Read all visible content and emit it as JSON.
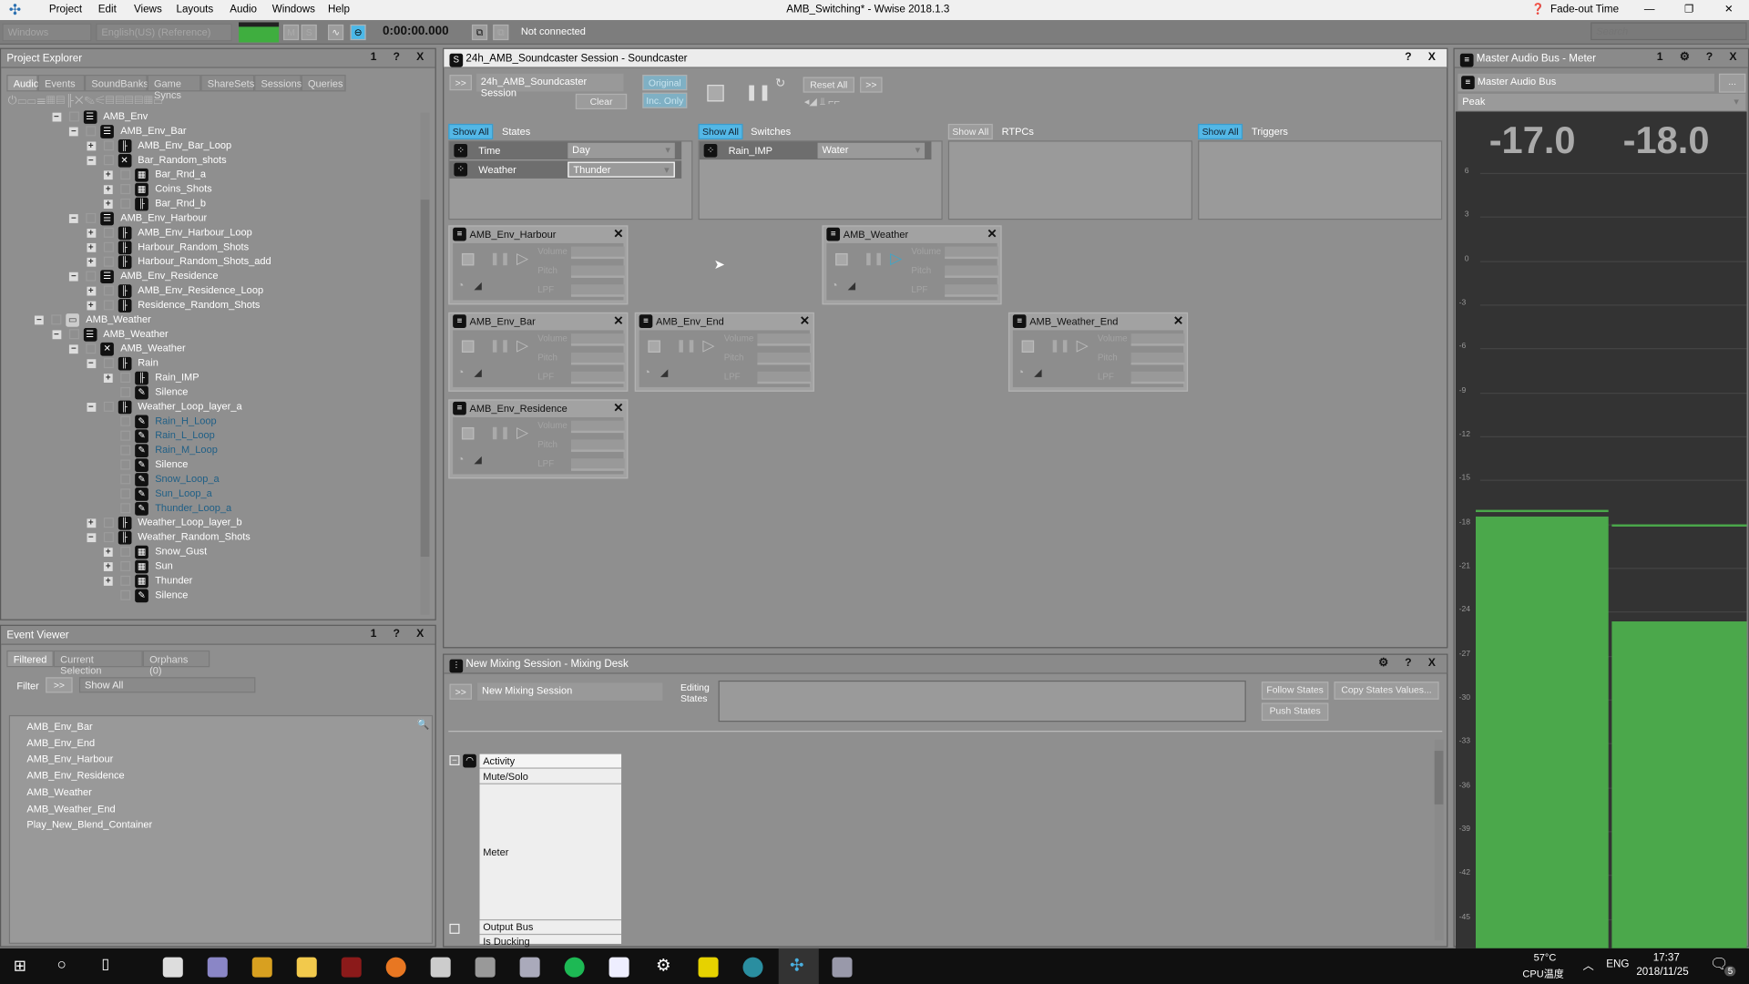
{
  "app": {
    "title": "AMB_Switching* - Wwise 2018.1.3",
    "fade_out": "Fade-out Time",
    "menu": [
      "Project",
      "Edit",
      "Views",
      "Layouts",
      "Audio",
      "Windows",
      "Help"
    ]
  },
  "toolbar": {
    "platform": "Windows",
    "language": "English(US) (Reference)",
    "m": "M",
    "s": "S",
    "time": "0:00:00.000",
    "connection": "Not connected",
    "search_placeholder": "Search"
  },
  "project_explorer": {
    "title": "Project Explorer",
    "tabs": [
      "Audio",
      "Events",
      "SoundBanks",
      "Game Syncs",
      "ShareSets",
      "Sessions",
      "Queries"
    ],
    "tree": [
      {
        "label": "AMB_Env",
        "depth": 1,
        "exp": "-",
        "icon": "mixer"
      },
      {
        "label": "AMB_Env_Bar",
        "depth": 2,
        "exp": "-",
        "icon": "mixer"
      },
      {
        "label": "AMB_Env_Bar_Loop",
        "depth": 3,
        "exp": "+",
        "icon": "blend"
      },
      {
        "label": "Bar_Random_shots",
        "depth": 3,
        "exp": "-",
        "icon": "random"
      },
      {
        "label": "Bar_Rnd_a",
        "depth": 4,
        "exp": "+",
        "icon": "grid"
      },
      {
        "label": "Coins_Shots",
        "depth": 4,
        "exp": "+",
        "icon": "grid"
      },
      {
        "label": "Bar_Rnd_b",
        "depth": 4,
        "exp": "+",
        "icon": "blend"
      },
      {
        "label": "AMB_Env_Harbour",
        "depth": 2,
        "exp": "-",
        "icon": "mixer"
      },
      {
        "label": "AMB_Env_Harbour_Loop",
        "depth": 3,
        "exp": "+",
        "icon": "blend"
      },
      {
        "label": "Harbour_Random_Shots",
        "depth": 3,
        "exp": "+",
        "icon": "blend"
      },
      {
        "label": "Harbour_Random_Shots_add",
        "depth": 3,
        "exp": "+",
        "icon": "blend"
      },
      {
        "label": "AMB_Env_Residence",
        "depth": 2,
        "exp": "-",
        "icon": "mixer"
      },
      {
        "label": "AMB_Env_Residence_Loop",
        "depth": 3,
        "exp": "+",
        "icon": "blend"
      },
      {
        "label": "Residence_Random_Shots",
        "depth": 3,
        "exp": "+",
        "icon": "blend"
      },
      {
        "label": "AMB_Weather",
        "depth": 0,
        "exp": "-",
        "icon": "folder"
      },
      {
        "label": "AMB_Weather",
        "depth": 1,
        "exp": "-",
        "icon": "mixer"
      },
      {
        "label": "AMB_Weather",
        "depth": 2,
        "exp": "-",
        "icon": "switch"
      },
      {
        "label": "Rain",
        "depth": 3,
        "exp": "-",
        "icon": "blend"
      },
      {
        "label": "Rain_IMP",
        "depth": 4,
        "exp": "+",
        "icon": "blend"
      },
      {
        "label": "Silence",
        "depth": 4,
        "exp": "",
        "icon": "sound"
      },
      {
        "label": "Weather_Loop_layer_a",
        "depth": 3,
        "exp": "-",
        "icon": "blend"
      },
      {
        "label": "Rain_H_Loop",
        "depth": 4,
        "exp": "",
        "icon": "sound",
        "blue": true
      },
      {
        "label": "Rain_L_Loop",
        "depth": 4,
        "exp": "",
        "icon": "sound",
        "blue": true
      },
      {
        "label": "Rain_M_Loop",
        "depth": 4,
        "exp": "",
        "icon": "sound",
        "blue": true
      },
      {
        "label": "Silence",
        "depth": 4,
        "exp": "",
        "icon": "sound"
      },
      {
        "label": "Snow_Loop_a",
        "depth": 4,
        "exp": "",
        "icon": "sound",
        "blue": true
      },
      {
        "label": "Sun_Loop_a",
        "depth": 4,
        "exp": "",
        "icon": "sound",
        "blue": true
      },
      {
        "label": "Thunder_Loop_a",
        "depth": 4,
        "exp": "",
        "icon": "sound",
        "blue": true
      },
      {
        "label": "Weather_Loop_layer_b",
        "depth": 3,
        "exp": "+",
        "icon": "blend"
      },
      {
        "label": "Weather_Random_Shots",
        "depth": 3,
        "exp": "-",
        "icon": "blend"
      },
      {
        "label": "Snow_Gust",
        "depth": 4,
        "exp": "+",
        "icon": "grid"
      },
      {
        "label": "Sun",
        "depth": 4,
        "exp": "+",
        "icon": "grid"
      },
      {
        "label": "Thunder",
        "depth": 4,
        "exp": "+",
        "icon": "grid"
      },
      {
        "label": "Silence",
        "depth": 4,
        "exp": "",
        "icon": "sound"
      }
    ]
  },
  "event_viewer": {
    "title": "Event Viewer",
    "tabs": [
      "Filtered",
      "Current Selection",
      "Orphans (0)"
    ],
    "filter_label": "Filter",
    "filter_btn": ">>",
    "filter_value": "Show All",
    "events": [
      "AMB_Env_Bar",
      "AMB_Env_End",
      "AMB_Env_Harbour",
      "AMB_Env_Residence",
      "AMB_Weather",
      "AMB_Weather_End",
      "Play_New_Blend_Container"
    ]
  },
  "soundcaster": {
    "title": "24h_AMB_Soundcaster Session - Soundcaster",
    "expand": ">>",
    "session": "24h_AMB_Soundcaster Session",
    "original": "Original",
    "inc_only": "Inc. Only",
    "clear": "Clear",
    "reset_all": "Reset All",
    "more": ">>",
    "show_all": "Show All",
    "states_label": "States",
    "switches_label": "Switches",
    "rtpcs_label": "RTPCs",
    "triggers_label": "Triggers",
    "states": [
      {
        "name": "Time",
        "value": "Day"
      },
      {
        "name": "Weather",
        "value": "Thunder"
      }
    ],
    "switches": [
      {
        "name": "Rain_IMP",
        "value": "Water"
      }
    ],
    "param_labels": [
      "Volume",
      "Pitch",
      "LPF"
    ],
    "cards": [
      {
        "name": "AMB_Env_Harbour",
        "playing": false
      },
      {
        "name": "AMB_Weather",
        "playing": true
      },
      {
        "name": "AMB_Env_Bar",
        "playing": false
      },
      {
        "name": "AMB_Env_End",
        "playing": false
      },
      {
        "name": "AMB_Weather_End",
        "playing": false
      },
      {
        "name": "AMB_Env_Residence",
        "playing": false
      }
    ]
  },
  "mixing_desk": {
    "title": "New Mixing Session - Mixing Desk",
    "expand": ">>",
    "session": "New Mixing Session",
    "editing_states": "Editing States",
    "follow_states": "Follow States",
    "copy_states": "Copy States Values...",
    "push_states": "Push States",
    "rows": [
      "Activity",
      "Mute/Solo",
      "Meter",
      "Output Bus",
      "Is Ducking"
    ]
  },
  "meter": {
    "title": "Master Audio Bus - Meter",
    "bus": "Master Audio Bus",
    "more": "...",
    "mode": "Peak",
    "left_peak": "-17.0",
    "right_peak": "-18.0",
    "left_level_db": -17.5,
    "right_level_db": -24.7,
    "left_peak_db": -17.0,
    "right_peak_db": -18.0,
    "scale": [
      "6",
      "3",
      "0",
      "-3",
      "-6",
      "-9",
      "-12",
      "-15",
      "-18",
      "-21",
      "-24",
      "-27",
      "-30",
      "-33",
      "-36",
      "-39",
      "-42",
      "-45"
    ],
    "bar_color": "#4ba84b"
  },
  "taskbar": {
    "temp": "57°C",
    "temp_label": "CPU温度",
    "lang": "ENG",
    "time": "17:37",
    "date": "2018/11/25",
    "notifications": "5"
  }
}
